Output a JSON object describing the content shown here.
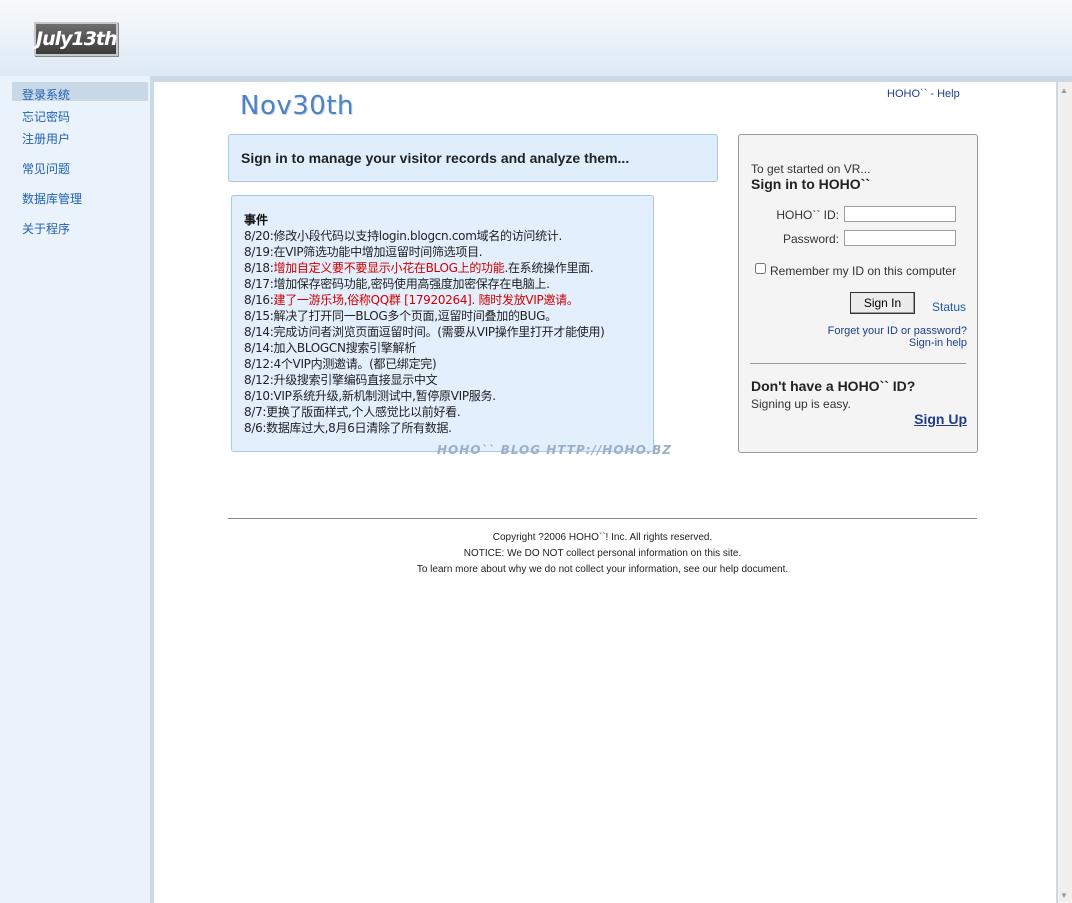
{
  "header": {
    "logo_text": "July13th"
  },
  "sidebar": {
    "items": [
      {
        "label": "登录系统"
      },
      {
        "label": "忘记密码"
      },
      {
        "label": "注册用户"
      },
      {
        "label": "常见问题"
      },
      {
        "label": "数据库管理"
      },
      {
        "label": "关于程序"
      }
    ],
    "active_index": 0
  },
  "brand": {
    "title": "Nov30th"
  },
  "help_link": "HOHO`` - Help",
  "banner": {
    "text": "Sign in to manage your visitor records and analyze them..."
  },
  "news": {
    "title": "事件",
    "items": [
      {
        "date": "8/20:",
        "text": "修改小段代码以支持login.blogcn.com域名的访问统计.",
        "rest": "",
        "highlight": false
      },
      {
        "date": "8/19:",
        "text": "在VIP筛选功能中增加逗留时间筛选项目.",
        "rest": "",
        "highlight": false
      },
      {
        "date": "8/18:",
        "text": "增加自定义要不要显示小花在BLOG上的功能",
        "rest": ".在系统操作里面.",
        "highlight": true
      },
      {
        "date": "8/17:",
        "text": "增加保存密码功能,密码使用高强度加密保存在电脑上.",
        "rest": "",
        "highlight": false
      },
      {
        "date": "8/16:",
        "text": "建了一游乐场,俗称QQ群 [17920264]. 随时发放VIP邀请。",
        "rest": "",
        "highlight": true
      },
      {
        "date": "8/15:",
        "text": "解决了打开同一BLOG多个页面,逗留时间叠加的BUG。",
        "rest": "",
        "highlight": false
      },
      {
        "date": "8/14:",
        "text": "完成访问者浏览页面逗留时间。(需要从VIP操作里打开才能使用)",
        "rest": "",
        "highlight": false
      },
      {
        "date": "8/14:",
        "text": "加入BLOGCN搜索引擎解析",
        "rest": "",
        "highlight": false
      },
      {
        "date": "8/12:",
        "text": "4个VIP内测邀请。(都已绑定完)",
        "rest": "",
        "highlight": false
      },
      {
        "date": "8/12:",
        "text": "升级搜索引擎编码直接显示中文",
        "rest": "",
        "highlight": false
      },
      {
        "date": "8/10:",
        "text": "VIP系统升级,新机制测试中,暂停原VIP服务.",
        "rest": "",
        "highlight": false
      },
      {
        "date": "8/7:",
        "text": "更换了版面样式,个人感觉比以前好看.",
        "rest": "",
        "highlight": false
      },
      {
        "date": "8/6:",
        "text": "数据库过大,8月6日清除了所有数据.",
        "rest": "",
        "highlight": false
      }
    ],
    "watermark": "HOHO`` BLOG   HTTP://HOHO.BZ"
  },
  "signin": {
    "started": "To get started on VR...",
    "title": "Sign in to HOHO``",
    "id_label": "HOHO`` ID:",
    "id_value": "",
    "password_label": "Password:",
    "password_value": "",
    "remember_label": "Remember my ID on this computer",
    "remember_checked": false,
    "button_label": "Sign In",
    "status_link": "Status",
    "forgot_link": "Forget your ID or password?",
    "help_link": "Sign-in help",
    "no_id_question": "Don't have a HOHO`` ID?",
    "signup_easy": "Signing up is easy.",
    "signup_link": "Sign Up"
  },
  "footer": {
    "copyright": "Copyright ?2006 HOHO``! Inc. All rights reserved.",
    "notice": "NOTICE: We DO NOT collect personal information on this site.",
    "learn_more": "To learn more about why we do not collect your information, see our help document."
  },
  "colors": {
    "link": "#2262b4",
    "highlight_red": "#d00000",
    "panel_bg": "#e3effc",
    "panel_border": "#a9c7e8",
    "nav_bg": "#eaf3fb",
    "nav_active": "#c9d8e6"
  },
  "icons": [
    "scroll-up-arrow-icon",
    "scroll-down-arrow-icon"
  ]
}
